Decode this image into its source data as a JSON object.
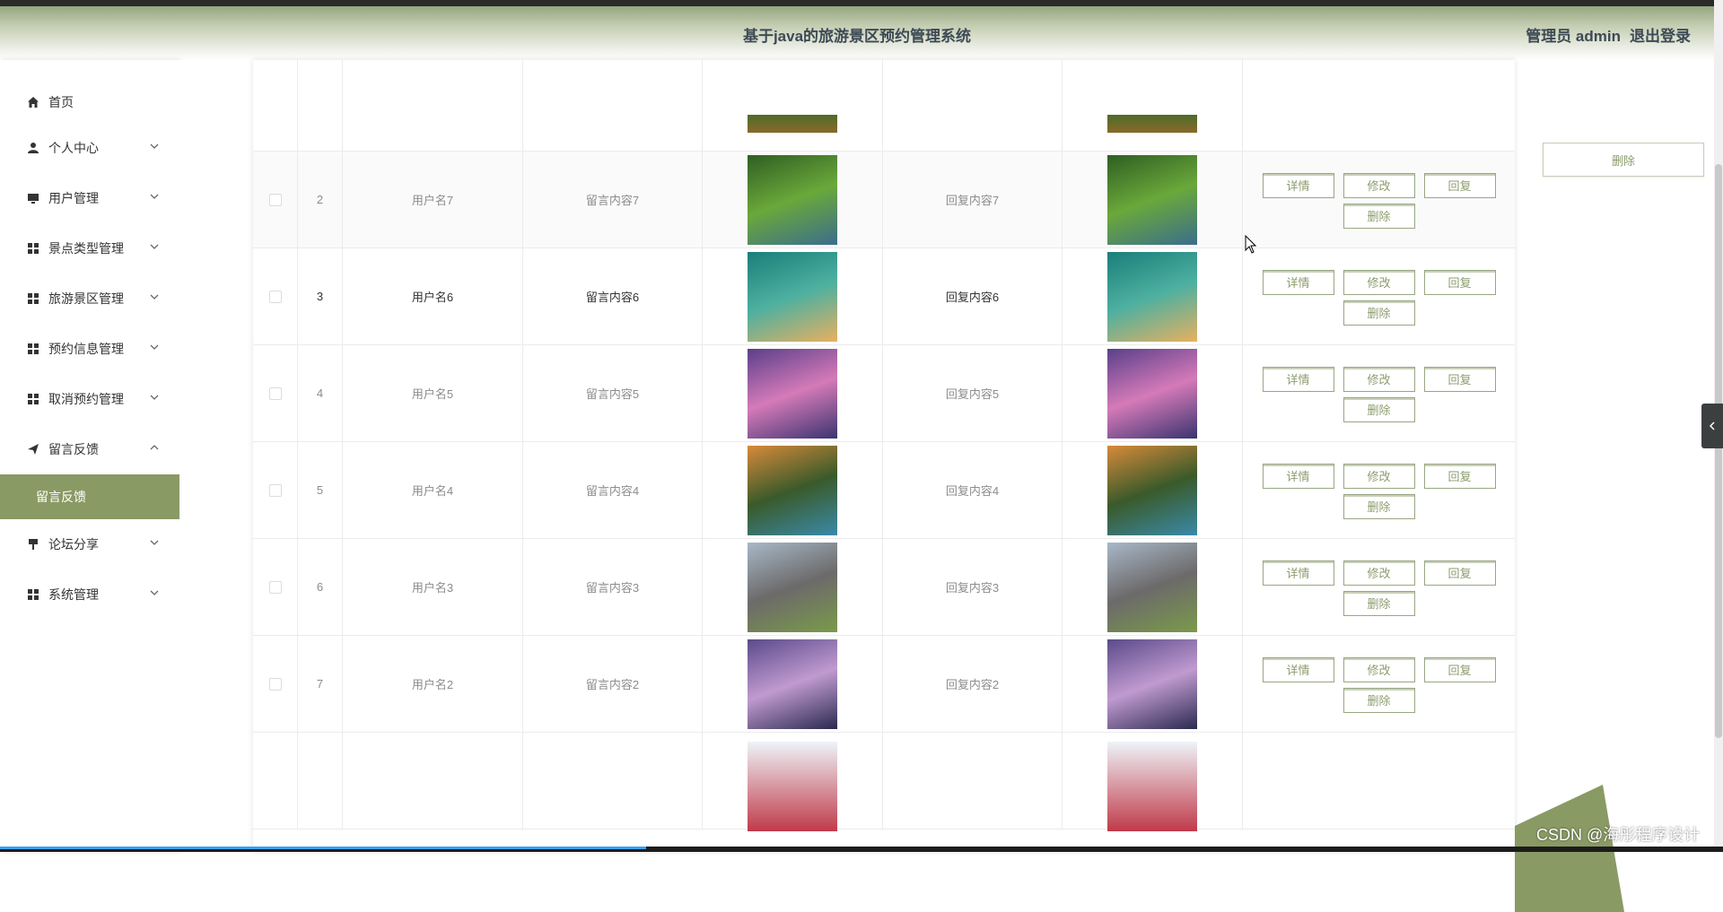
{
  "header": {
    "title": "基于java的旅游景区预约管理系统",
    "user_label": "管理员 admin",
    "logout_label": "退出登录"
  },
  "sidebar": {
    "home": "首页",
    "items": [
      {
        "label": "个人中心",
        "icon": "user-icon"
      },
      {
        "label": "用户管理",
        "icon": "monitor-icon"
      },
      {
        "label": "景点类型管理",
        "icon": "grid-icon"
      },
      {
        "label": "旅游景区管理",
        "icon": "grid-icon"
      },
      {
        "label": "预约信息管理",
        "icon": "grid-icon"
      },
      {
        "label": "取消预约管理",
        "icon": "grid-icon"
      }
    ],
    "active_group": "留言反馈",
    "active_sub": "留言反馈",
    "after_items": [
      {
        "label": "论坛分享",
        "icon": "pin-icon"
      },
      {
        "label": "系统管理",
        "icon": "grid-icon"
      }
    ]
  },
  "table": {
    "rows": [
      {
        "index": "2",
        "username": "用户名7",
        "message": "留言内容7",
        "reply": "回复内容7",
        "image_colors": [
          "#2f5e22",
          "#6aa83a",
          "#3a6e8c"
        ]
      },
      {
        "index": "3",
        "username": "用户名6",
        "message": "留言内容6",
        "reply": "回复内容6",
        "image_colors": [
          "#1b7e7a",
          "#4db0a0",
          "#e8b060"
        ]
      },
      {
        "index": "4",
        "username": "用户名5",
        "message": "留言内容5",
        "reply": "回复内容5",
        "image_colors": [
          "#5a3f8a",
          "#d57ab8",
          "#3a3470"
        ]
      },
      {
        "index": "5",
        "username": "用户名4",
        "message": "留言内容4",
        "reply": "回复内容4",
        "image_colors": [
          "#d78a3a",
          "#3a5a2a",
          "#3a8aa8"
        ]
      },
      {
        "index": "6",
        "username": "用户名3",
        "message": "留言内容3",
        "reply": "回复内容3",
        "image_colors": [
          "#a8b8c8",
          "#6c6a6a",
          "#7a9a4a"
        ]
      },
      {
        "index": "7",
        "username": "用户名2",
        "message": "留言内容2",
        "reply": "回复内容2",
        "image_colors": [
          "#5a4a8a",
          "#c09ad0",
          "#2a2a50"
        ]
      }
    ],
    "buttons": {
      "detail": "详情",
      "edit": "修改",
      "reply": "回复",
      "delete": "删除"
    }
  },
  "side_panel": {
    "delete_label": "删除"
  },
  "watermark": "CSDN @海彤程序设计",
  "colors": {
    "accent": "#8a9a64",
    "button_text": "#8c9c6e"
  }
}
